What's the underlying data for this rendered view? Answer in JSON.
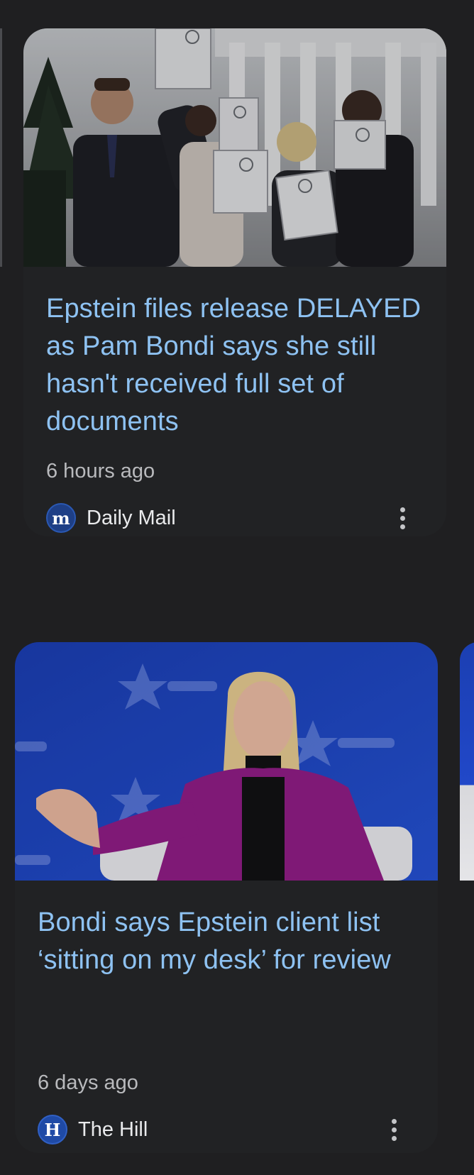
{
  "feed": {
    "articles": [
      {
        "headline": "Epstein files release DELAYED as Pam Bondi says she still hasn't received full set of documents",
        "timestamp": "6 hours ago",
        "source": {
          "name": "Daily Mail",
          "logo_letter": "m",
          "logo_color": "#1e3f86"
        },
        "image_alt": "Group holding binders outside the White House"
      },
      {
        "headline": "Bondi says Epstein client list ‘sitting on my desk’ for review",
        "timestamp": "6 days ago",
        "source": {
          "name": "The Hill",
          "logo_letter": "H",
          "logo_color": "#1f4aa6"
        },
        "image_alt": "Woman in magenta blazer speaking on stage"
      }
    ]
  },
  "colors": {
    "background": "#1f1f21",
    "card": "#212224",
    "headline": "#8ec2f2",
    "timestamp": "#b9babd",
    "source_text": "#e9eaec"
  }
}
